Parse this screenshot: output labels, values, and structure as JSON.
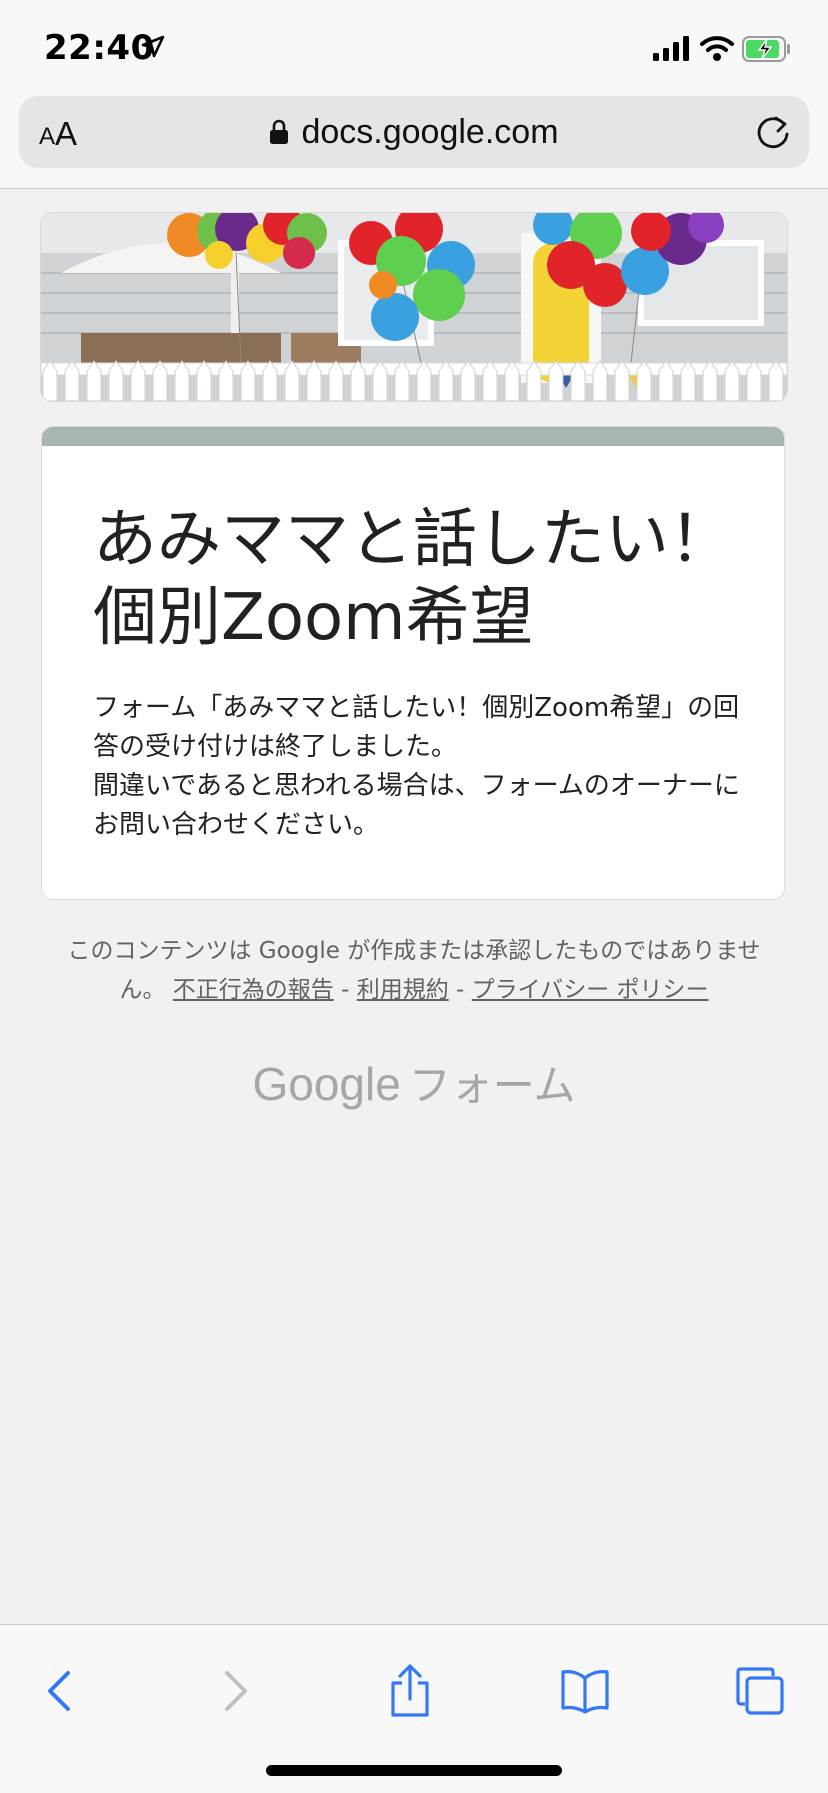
{
  "status_bar": {
    "time": "22:40",
    "icons": [
      "location-arrow-icon",
      "cellular-signal-icon",
      "wifi-icon",
      "battery-charging-icon"
    ]
  },
  "address_bar": {
    "text_size_small": "A",
    "text_size_large": "A",
    "url": "docs.google.com",
    "icons": [
      "lock-icon",
      "reload-icon"
    ]
  },
  "form": {
    "title_line1": "あみママと話したい！",
    "title_line2": "個別Zoom希望",
    "message_line1": "フォーム「あみママと話したい！個別Zoom希望」の回答の受け付けは終了しました。",
    "message_line2": "間違いであると思われる場合は、フォームのオーナーにお問い合わせください。",
    "accent_color": "#a9b6ad"
  },
  "footer": {
    "disclaimer": "このコンテンツは Google が作成または承認したものではありません。",
    "links": {
      "report_abuse": "不正行為の報告",
      "terms": "利用規約",
      "privacy": "プライバシー ポリシー"
    },
    "separator": "-",
    "logo_google": "Google",
    "logo_forms": "フォーム"
  },
  "toolbar": {
    "icons": [
      "back-icon",
      "forward-icon",
      "share-icon",
      "bookmarks-icon",
      "tabs-icon"
    ],
    "active_color": "#3478f6",
    "disabled_color": "#bfbfc3"
  }
}
